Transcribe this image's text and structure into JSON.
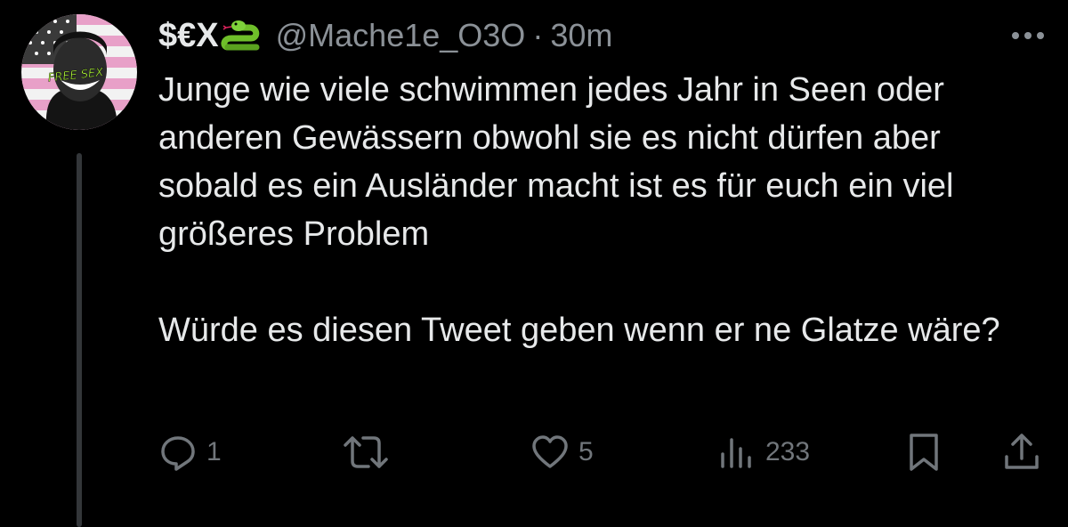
{
  "tweet": {
    "display_name": "$€X",
    "handle": "@Mache1e_O3O",
    "separator": "·",
    "time": "30m",
    "text_paragraphs": [
      "Junge wie viele schwimmen jedes Jahr in Seen oder anderen Gewässern obwohl sie es nicht dürfen aber sobald es ein Ausländer macht ist es für euch ein viel größeres Problem",
      "Würde es diesen Tweet geben wenn er ne Glatze wäre?"
    ],
    "avatar_caption": "FREE SEX"
  },
  "actions": {
    "reply_count": "1",
    "retweet_count": "",
    "like_count": "5",
    "views_count": "233"
  },
  "icons": {
    "display_name_emoji": "snake-icon",
    "more": "more-icon",
    "reply": "reply-icon",
    "retweet": "retweet-icon",
    "like": "heart-icon",
    "views": "views-icon",
    "bookmark": "bookmark-icon",
    "share": "share-icon"
  },
  "colors": {
    "background": "#000000",
    "text_primary": "#e7e9ea",
    "text_secondary": "#71767b",
    "avatar_flag_red": "#e8a0c8",
    "avatar_caption": "#b5ff3a"
  }
}
